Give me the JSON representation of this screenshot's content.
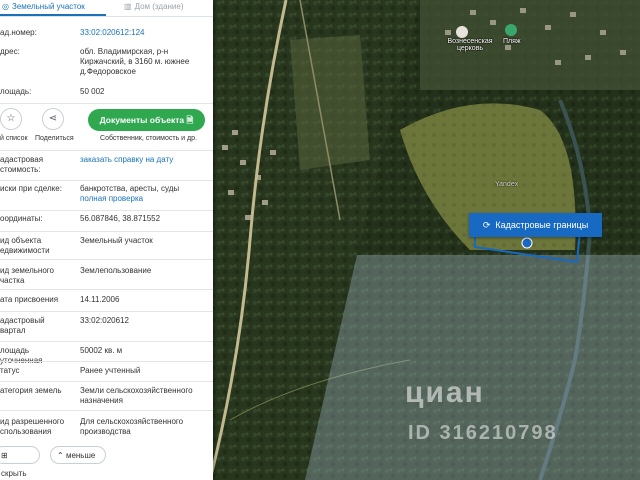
{
  "tabs": {
    "land": "Земельный участок",
    "building": "Дом (здание)"
  },
  "details": {
    "cad_number_label": "ад.номер:",
    "cad_number_value": "33:02:020612:124",
    "address_label": "дрес:",
    "address_value": "обл. Владимирская, р-н Киржачский, в 3160 м. южнее д.Федоровское",
    "area_label": "лощадь:",
    "area_value": "50 002"
  },
  "actions": {
    "list_label": "й список",
    "share_label": "Поделиться",
    "documents_button": "Документы объекта",
    "documents_sub": "Собственник, стоимость и др."
  },
  "fields": [
    {
      "label": "адастровая стоимость:",
      "value": "заказать справку на дату",
      "link": true
    },
    {
      "label": "иски при сделке:",
      "value": "банкротства, аресты, суды",
      "sub": "полная проверка"
    },
    {
      "label": "оординаты:",
      "value": "56.087846, 38.871552"
    },
    {
      "label": "ид объекта едвижимости",
      "value": "Земельный участок"
    },
    {
      "label": "ид земельного частка",
      "value": "Землепользование"
    },
    {
      "label": "ата присвоения",
      "value": "14.11.2006"
    },
    {
      "label": "адастровый вартал",
      "value": "33:02:020612"
    },
    {
      "label": "лощадь уточненная",
      "value": "50002 кв. м"
    },
    {
      "label": "татус",
      "value": "Ранее учтенный"
    },
    {
      "label": "атегория земель",
      "value": "Земли сельскохозяйственного назначения"
    },
    {
      "label": "ид разрешенного спользования",
      "value": "Для сельскохозяйственного производства"
    }
  ],
  "bottom": {
    "hide": "скрыть",
    "less": "меньше"
  },
  "map": {
    "cadastral_button": "Кадастровые границы",
    "church_label": "Вознесенская церковь",
    "beach_label": "Пляж",
    "yandex_label": "Yandex",
    "watermark": "циан",
    "watermark_id": "ID 316210798"
  },
  "colors": {
    "accent": "#1a73b8",
    "doc_button": "#2fa84f",
    "cad_button": "#1769c2"
  }
}
